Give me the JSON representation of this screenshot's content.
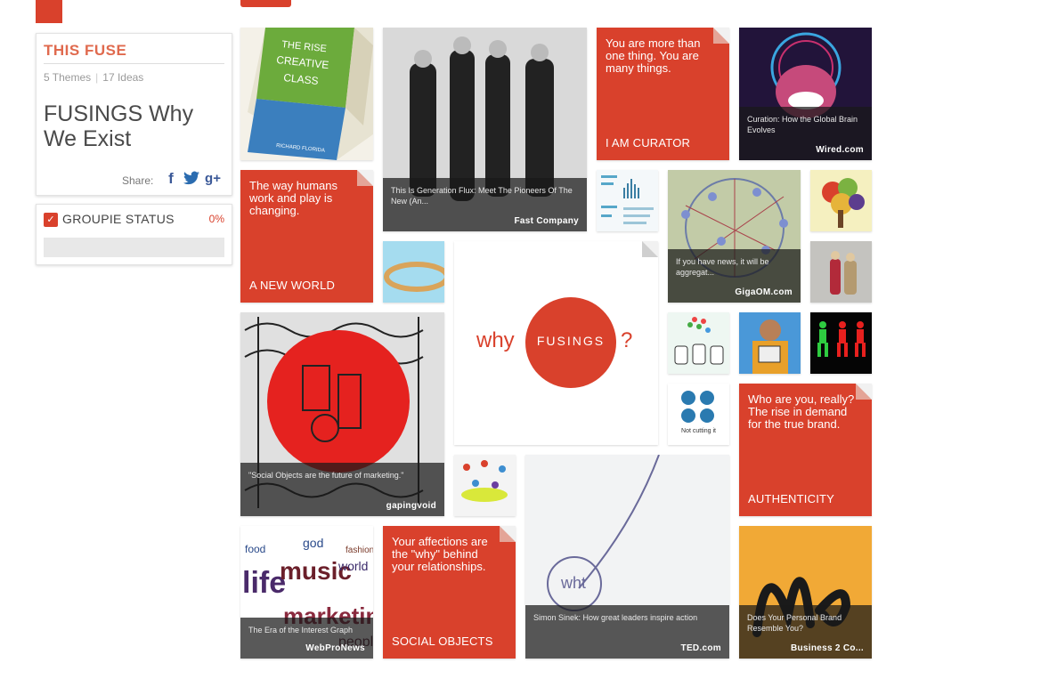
{
  "colors": {
    "accent": "#d9412c",
    "link_blue": "#3b5998"
  },
  "fuse": {
    "section_label": "THIS FUSE",
    "themes": "5 Themes",
    "ideas": "17 Ideas",
    "title": "FUSINGS Why We Exist",
    "share_label": "Share:"
  },
  "groupie": {
    "label": "GROUPIE STATUS",
    "percent": "0%",
    "progress": 0
  },
  "tiles": {
    "book": {
      "alt_icon": "book-cover-rise-of-creative-class"
    },
    "fastcompany": {
      "caption": "This Is Generation Flux: Meet The Pioneers Of The New (An...",
      "source": "Fast Company"
    },
    "curator": {
      "quote": "You are more than one thing. You are many things.",
      "theme": "I AM CURATOR"
    },
    "wired": {
      "caption": "Curation: How the Global Brain Evolves",
      "source": "Wired.com"
    },
    "new_world": {
      "quote": "The way humans work and play is changing.",
      "theme": "A NEW WORLD"
    },
    "gigaom": {
      "caption": "If you have news, it will be aggregat...",
      "source": "GigaOM.com"
    },
    "why": {
      "word": "why",
      "brand": "FUSINGS",
      "mark": "?"
    },
    "social_icons": {
      "caption": "Not cutting it"
    },
    "gapingvoid": {
      "caption": "\"Social Objects are the future of marketing.\"",
      "source": "gapingvoid"
    },
    "authenticity": {
      "quote": "Who are you, really? The rise in demand for the true brand.",
      "theme": "AUTHENTICITY"
    },
    "webpronews": {
      "caption": "The Era of the Interest Graph",
      "source": "WebProNews"
    },
    "social_objects": {
      "quote": "Your affections are the \"why\" behind your relationships.",
      "theme": "SOCIAL OBJECTS"
    },
    "ted": {
      "caption": "Simon Sinek: How great leaders inspire action",
      "source": "TED.com"
    },
    "b2c": {
      "caption": "Does Your Personal Brand Resemble You?",
      "source": "Business 2 Co..."
    }
  }
}
